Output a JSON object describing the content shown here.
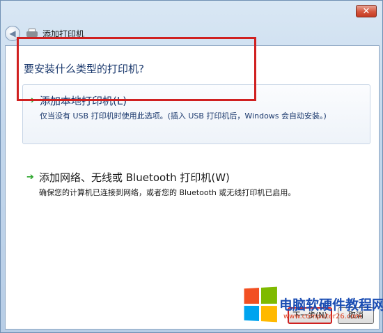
{
  "window": {
    "title": "添加打印机",
    "close_label": "✕"
  },
  "main": {
    "heading": "要安装什么类型的打印机?",
    "options": [
      {
        "title": "添加本地打印机(L)",
        "description": "仅当没有 USB 打印机时使用此选项。(插入 USB 打印机后，Windows 会自动安装。)"
      },
      {
        "title": "添加网络、无线或 Bluetooth 打印机(W)",
        "description": "确保您的计算机已连接到网络，或者您的 Bluetooth 或无线打印机已启用。"
      }
    ]
  },
  "footer": {
    "next_label": "下一步(N)",
    "cancel_label": "取消"
  },
  "watermark": {
    "text": "电脑软硬件教程网",
    "url": "www.computer26.com"
  },
  "colors": {
    "highlight": "#d02020",
    "link_blue": "#1c3a6e",
    "arrow_green": "#2aa52a"
  },
  "icons": {
    "back": "back-arrow-icon",
    "printer": "printer-icon",
    "option_arrow": "green-arrow-icon"
  }
}
